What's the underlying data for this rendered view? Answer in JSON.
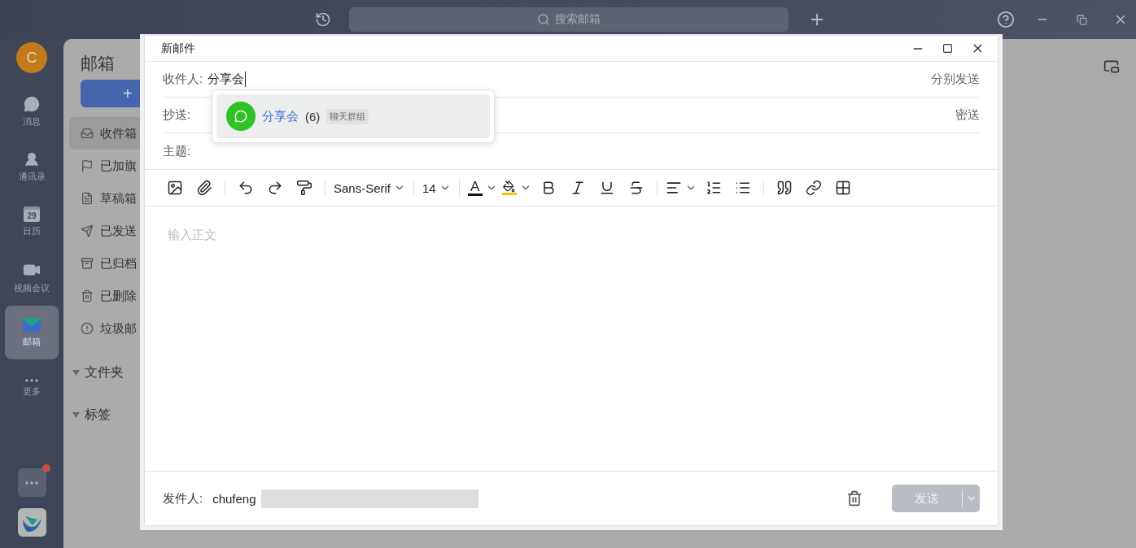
{
  "top_bar": {
    "search": {
      "placeholder": "搜索邮箱"
    }
  },
  "rail": {
    "avatar": "C",
    "items": [
      {
        "kind": "chat",
        "label": "消息",
        "selected": false
      },
      {
        "kind": "contacts",
        "label": "通讯录",
        "selected": false
      },
      {
        "kind": "calendar",
        "label": "日历",
        "day": "29",
        "selected": false
      },
      {
        "kind": "video",
        "label": "视频会议",
        "selected": false
      },
      {
        "kind": "mail",
        "label": "邮箱",
        "selected": true
      },
      {
        "kind": "more",
        "label": "更多",
        "selected": false
      }
    ],
    "bottom": {
      "unread": true
    }
  },
  "mail_sidebar": {
    "title": "邮箱",
    "new_button": "+",
    "folders": [
      {
        "kind": "inbox",
        "label": "收件箱",
        "selected": true
      },
      {
        "kind": "flag",
        "label": "已加旗",
        "selected": false
      },
      {
        "kind": "draft",
        "label": "草稿箱",
        "selected": false
      },
      {
        "kind": "sent",
        "label": "已发送",
        "selected": false
      },
      {
        "kind": "archive",
        "label": "已归档",
        "selected": false
      },
      {
        "kind": "trash",
        "label": "已删除",
        "selected": false
      },
      {
        "kind": "spam",
        "label": "垃圾邮",
        "selected": false
      }
    ],
    "groups": [
      {
        "label": "文件夹",
        "expanded": true
      },
      {
        "label": "标签",
        "expanded": true
      }
    ]
  },
  "compose": {
    "title": "新邮件",
    "fields": [
      {
        "label": "收件人:",
        "value": "分享会",
        "action": "分别发送"
      },
      {
        "label": "抄送:",
        "action": "密送"
      },
      {
        "label": "主题:"
      }
    ],
    "suggestions": [
      {
        "name": "分享会",
        "count": "(6)",
        "tag": "聊天群组",
        "selected": true
      }
    ],
    "toolbar": [
      {
        "kind": "image"
      },
      {
        "kind": "attach"
      },
      {
        "kind": "separator"
      },
      {
        "kind": "undo"
      },
      {
        "kind": "redo"
      },
      {
        "kind": "painter"
      },
      {
        "kind": "separator"
      },
      {
        "kind": "select",
        "value": "Sans-Serif"
      },
      {
        "kind": "separator"
      },
      {
        "kind": "select",
        "value": "14"
      },
      {
        "kind": "separator"
      },
      {
        "kind": "text-color",
        "label": "A",
        "color": "#111111"
      },
      {
        "kind": "highlight",
        "color": "#f5c400"
      },
      {
        "kind": "bold"
      },
      {
        "kind": "italic"
      },
      {
        "kind": "underline"
      },
      {
        "kind": "strike"
      },
      {
        "kind": "separator"
      },
      {
        "kind": "align"
      },
      {
        "kind": "ordered-list"
      },
      {
        "kind": "bullet-list"
      },
      {
        "kind": "separator"
      },
      {
        "kind": "quote"
      },
      {
        "kind": "link"
      },
      {
        "kind": "table"
      }
    ],
    "body_placeholder": "输入正文",
    "footer": {
      "label": "发件人:",
      "sender": "chufeng",
      "redacted": true,
      "send": {
        "label": "发送",
        "disabled": true
      }
    }
  }
}
